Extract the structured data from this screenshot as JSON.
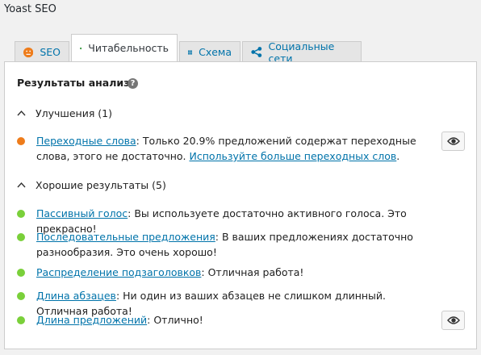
{
  "app": {
    "title": "Yoast SEO"
  },
  "tabs": [
    {
      "label": "SEO",
      "icon": "orange-face-icon"
    },
    {
      "label": "Читабельность",
      "icon": "green-smiley-icon"
    },
    {
      "label": "Схема",
      "icon": "grid-icon"
    },
    {
      "label": "Социальные сети",
      "icon": "share-icon"
    }
  ],
  "panel": {
    "title": "Результаты анализа",
    "help_icon": "?",
    "improvements": {
      "header": "Улучшения (1)",
      "items": [
        {
          "link": "Переходные слова",
          "text": ": Только 20.9% предложений содержат переходные слова, этого не достаточно. ",
          "link2": "Используйте больше переходных слов",
          "tail": ".",
          "status": "orange"
        }
      ]
    },
    "good": {
      "header": "Хорошие результаты (5)",
      "items": [
        {
          "link": "Пассивный голос",
          "text": ": Вы используете достаточно активного голоса. Это прекрасно!"
        },
        {
          "link": "Последовательные предложения",
          "text": ": В ваших предложениях достаточно разнообразия. Это очень хорошо!"
        },
        {
          "link": "Распределение подзаголовков",
          "text": ": Отличная работа!"
        },
        {
          "link": "Длина абзацев",
          "text": ": Ни один из ваших абзацев не слишком длинный. Отличная работа!"
        },
        {
          "link": "Длина предложений",
          "text": ": Отлично!"
        }
      ]
    }
  },
  "colors": {
    "orange": "#ee7c1b",
    "green": "#7ad03a",
    "link": "#0073aa"
  }
}
